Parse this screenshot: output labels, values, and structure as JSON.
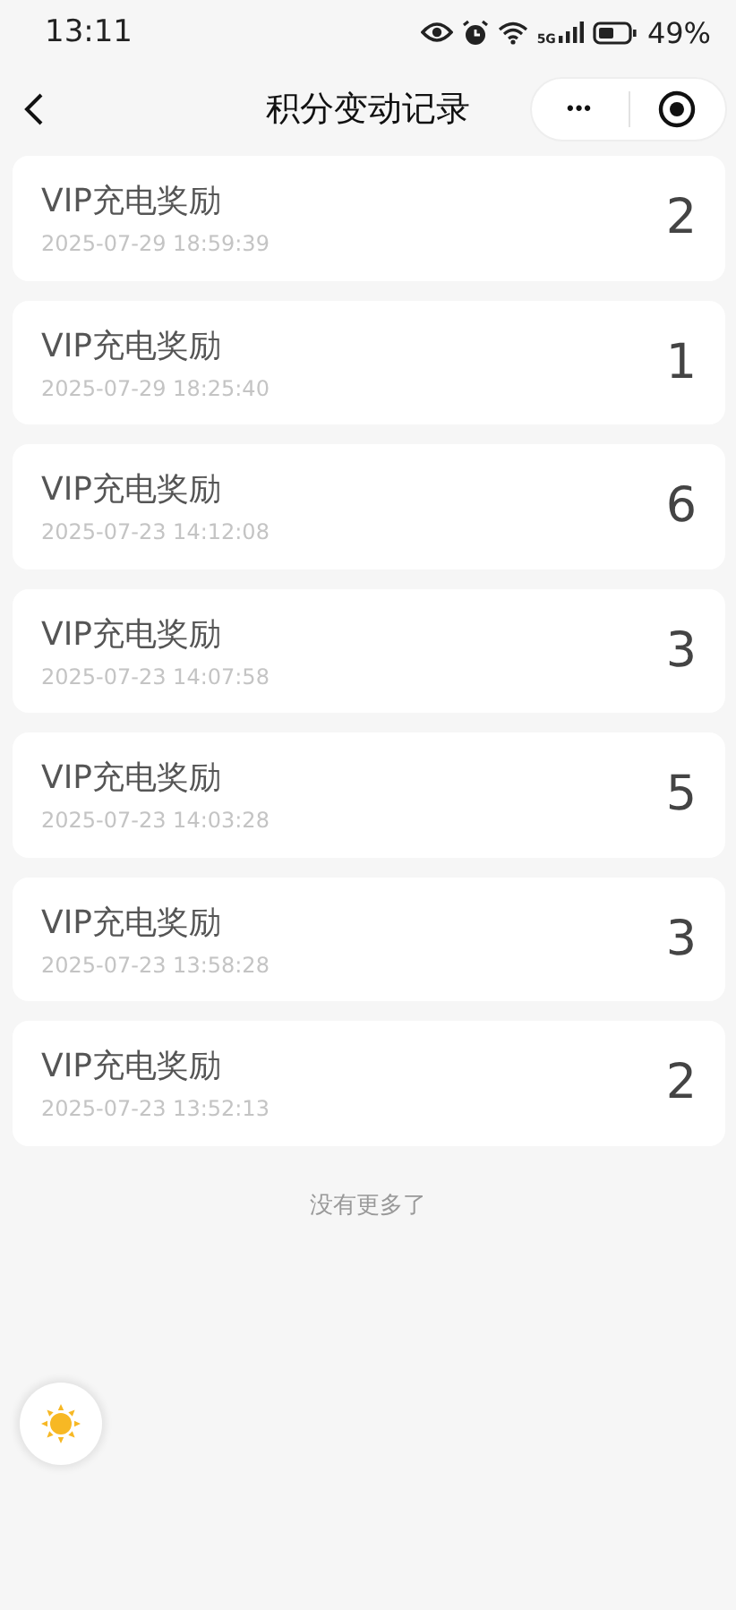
{
  "status_bar": {
    "time": "13:11",
    "network": "5G",
    "battery": "49%"
  },
  "nav_bar": {
    "title": "积分变动记录",
    "menu_button": "•••"
  },
  "records": [
    {
      "title": "VIP充电奖励",
      "time": "2025-07-29 18:59:39",
      "points": "2"
    },
    {
      "title": "VIP充电奖励",
      "time": "2025-07-29 18:25:40",
      "points": "1"
    },
    {
      "title": "VIP充电奖励",
      "time": "2025-07-23 14:12:08",
      "points": "6"
    },
    {
      "title": "VIP充电奖励",
      "time": "2025-07-23 14:07:58",
      "points": "3"
    },
    {
      "title": "VIP充电奖励",
      "time": "2025-07-23 14:03:28",
      "points": "5"
    },
    {
      "title": "VIP充电奖励",
      "time": "2025-07-23 13:58:28",
      "points": "3"
    },
    {
      "title": "VIP充电奖励",
      "time": "2025-07-23 13:52:13",
      "points": "2"
    }
  ],
  "footer": "没有更多了"
}
